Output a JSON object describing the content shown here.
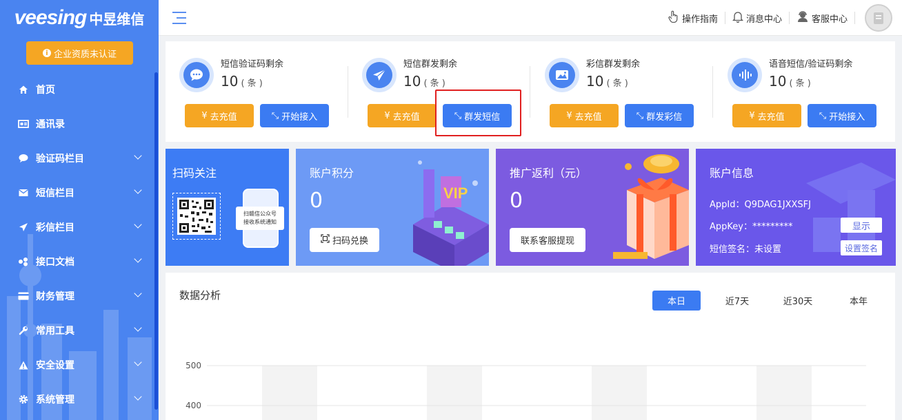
{
  "brand": {
    "logo_en": "veesing",
    "logo_cn": "中昱维信"
  },
  "sidebar": {
    "cert_label": "企业资质未认证",
    "items": [
      {
        "label": "首页",
        "icon": "home-icon",
        "expandable": false
      },
      {
        "label": "通讯录",
        "icon": "contacts-icon",
        "expandable": false
      },
      {
        "label": "验证码栏目",
        "icon": "chat-icon",
        "expandable": true
      },
      {
        "label": "短信栏目",
        "icon": "mail-icon",
        "expandable": true
      },
      {
        "label": "彩信栏目",
        "icon": "send-icon",
        "expandable": true
      },
      {
        "label": "接口文档",
        "icon": "api-icon",
        "expandable": true
      },
      {
        "label": "财务管理",
        "icon": "card-icon",
        "expandable": true
      },
      {
        "label": "常用工具",
        "icon": "wrench-icon",
        "expandable": true
      },
      {
        "label": "安全设置",
        "icon": "warning-icon",
        "expandable": true
      },
      {
        "label": "系统管理",
        "icon": "gear-icon",
        "expandable": true
      }
    ]
  },
  "header": {
    "guide": "操作指南",
    "messages": "消息中心",
    "service": "客服中心"
  },
  "balances": [
    {
      "name": "短信验证码剩余",
      "value": "10",
      "unit": "( 条 )",
      "btn1": "去充值",
      "btn2": "开始接入"
    },
    {
      "name": "短信群发剩余",
      "value": "10",
      "unit": "( 条 )",
      "btn1": "去充值",
      "btn2": "群发短信"
    },
    {
      "name": "彩信群发剩余",
      "value": "10",
      "unit": "( 条 )",
      "btn1": "去充值",
      "btn2": "群发彩信"
    },
    {
      "name": "语音短信/验证码剩余",
      "value": "10",
      "unit": "( 条 )",
      "btn1": "去充值",
      "btn2": "开始接入"
    }
  ],
  "cards": {
    "qr": {
      "title": "扫码关注",
      "phone_text_1": "扫赣信公众号",
      "phone_text_2": "接收系统通知"
    },
    "points": {
      "title": "账户积分",
      "value": "0",
      "button": "扫码兑换"
    },
    "rebate": {
      "title": "推广返利（元）",
      "value": "0",
      "button": "联系客服提现"
    },
    "account": {
      "title": "账户信息",
      "appid_label": "AppId：",
      "appid": "Q9DAG1JXXSFJ",
      "appkey_label": "AppKey：",
      "appkey": "*********",
      "show_btn": "显示",
      "sign_label": "短信签名：",
      "sign_value": "未设置",
      "sign_btn": "设置签名"
    }
  },
  "analysis": {
    "title": "数据分析",
    "tabs": [
      "本日",
      "近7天",
      "近30天",
      "本年"
    ],
    "active_tab": 0
  },
  "chart_data": {
    "type": "bar",
    "categories": [
      "",
      "",
      "",
      ""
    ],
    "values": [
      500,
      500,
      500,
      500
    ],
    "yticks": [
      500,
      400
    ],
    "ylim": [
      0,
      500
    ],
    "grid": true
  },
  "colors": {
    "sidebar": "#4a84f0",
    "primary": "#3b7bf2",
    "orange": "#f5a623",
    "highlight": "#e02020"
  }
}
